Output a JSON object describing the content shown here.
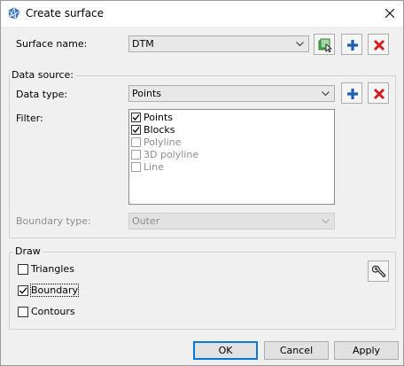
{
  "window": {
    "title": "Create surface",
    "icon": "surface-mesh-icon",
    "close_icon": "close-icon"
  },
  "surface": {
    "name_label": "Surface name:",
    "name_value": "DTM"
  },
  "data_source": {
    "group_label": "Data source:",
    "type_label": "Data type:",
    "type_value": "Points",
    "filter_label": "Filter:",
    "filter_items": [
      {
        "label": "Points",
        "checked": true,
        "enabled": true
      },
      {
        "label": "Blocks",
        "checked": true,
        "enabled": true
      },
      {
        "label": "Polyline",
        "checked": false,
        "enabled": false
      },
      {
        "label": "3D polyline",
        "checked": false,
        "enabled": false
      },
      {
        "label": "Line",
        "checked": false,
        "enabled": false
      }
    ],
    "boundary_label": "Boundary type:",
    "boundary_value": "Outer"
  },
  "draw": {
    "group_label": "Draw",
    "options": [
      {
        "label": "Triangles",
        "checked": false
      },
      {
        "label": "Boundary",
        "checked": true
      },
      {
        "label": "Contours",
        "checked": false
      }
    ],
    "settings_icon": "wrench-icon"
  },
  "buttons": {
    "ok": "OK",
    "cancel": "Cancel",
    "apply": "Apply"
  },
  "colors": {
    "add_blue": "#1e5fb4",
    "delete_red": "#d21e1e",
    "accent": "#0078d7"
  }
}
